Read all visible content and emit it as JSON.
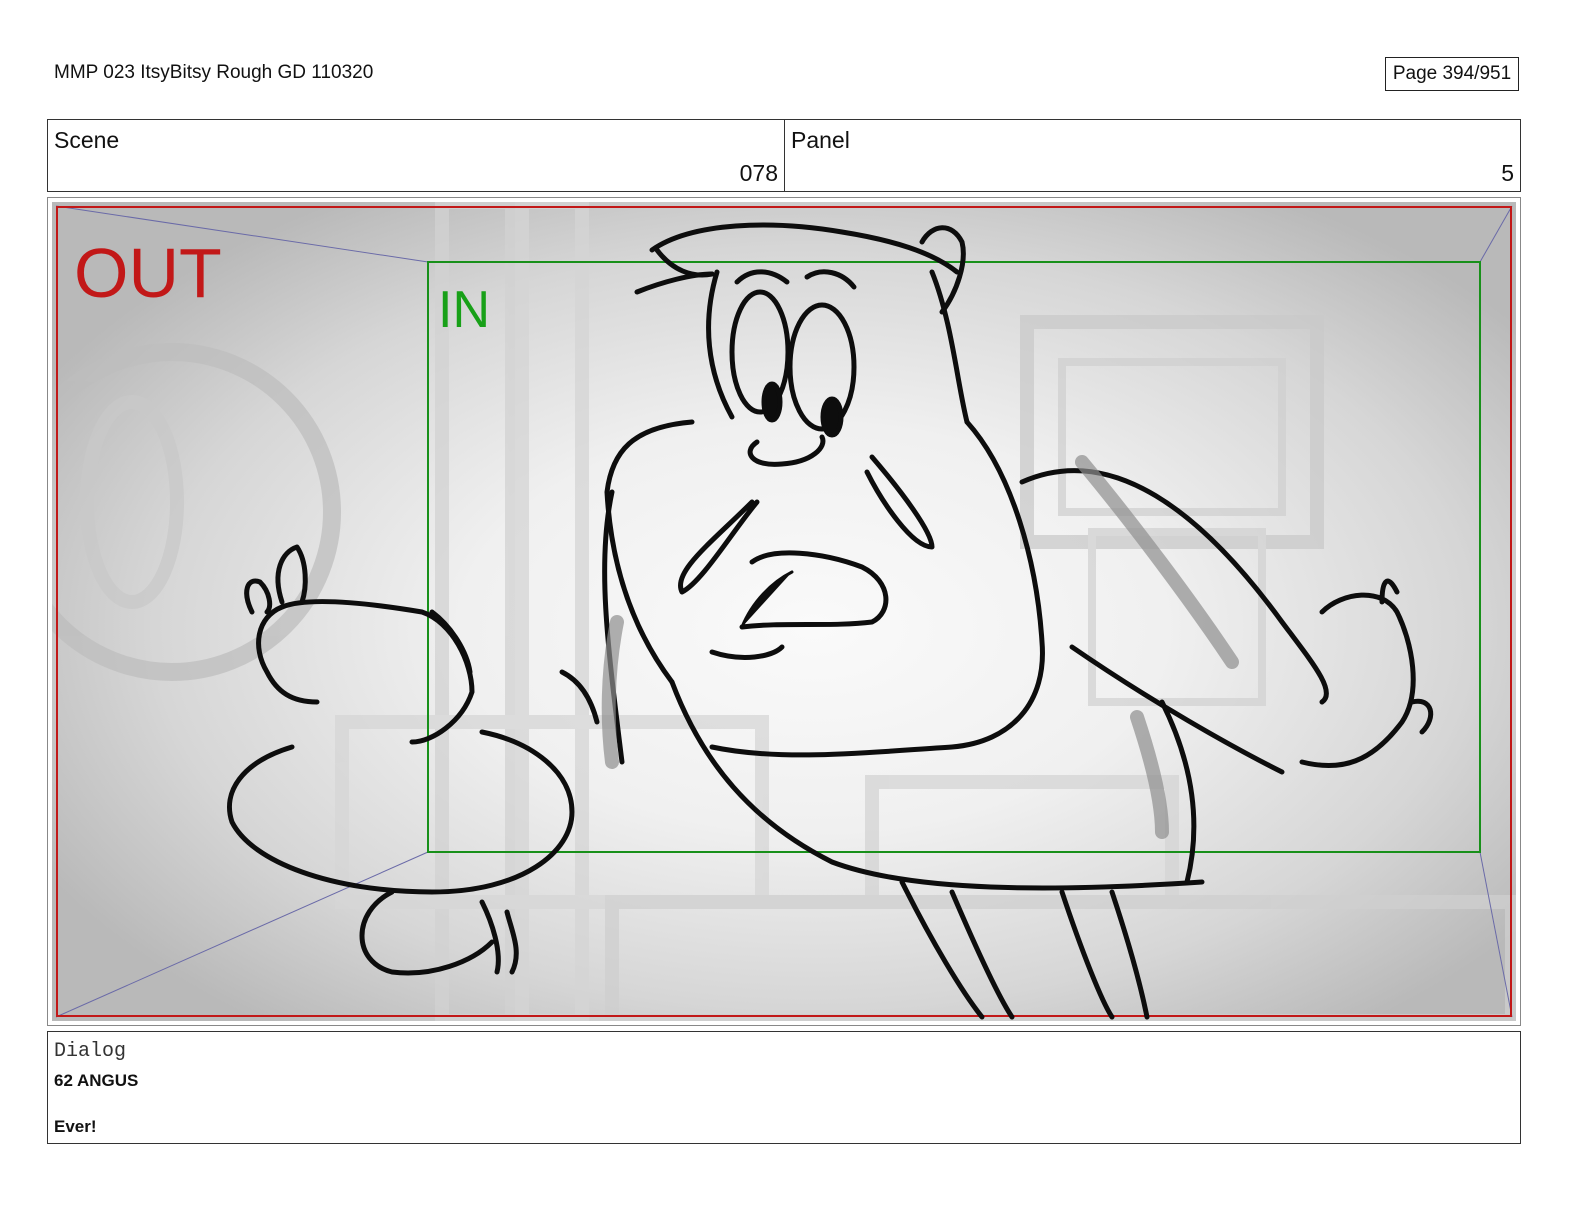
{
  "header": {
    "document_title": "MMP 023 ItsyBitsy Rough GD 110320",
    "page_label": "Page 394/951"
  },
  "scene": {
    "label": "Scene",
    "value": "078"
  },
  "panel": {
    "label": "Panel",
    "value": "5"
  },
  "frame": {
    "out_label": "OUT",
    "in_label": "IN",
    "out_color": "#c21818",
    "in_color": "#18a018"
  },
  "dialog": {
    "label": "Dialog",
    "speaker": "62 ANGUS",
    "line": "Ever!"
  }
}
